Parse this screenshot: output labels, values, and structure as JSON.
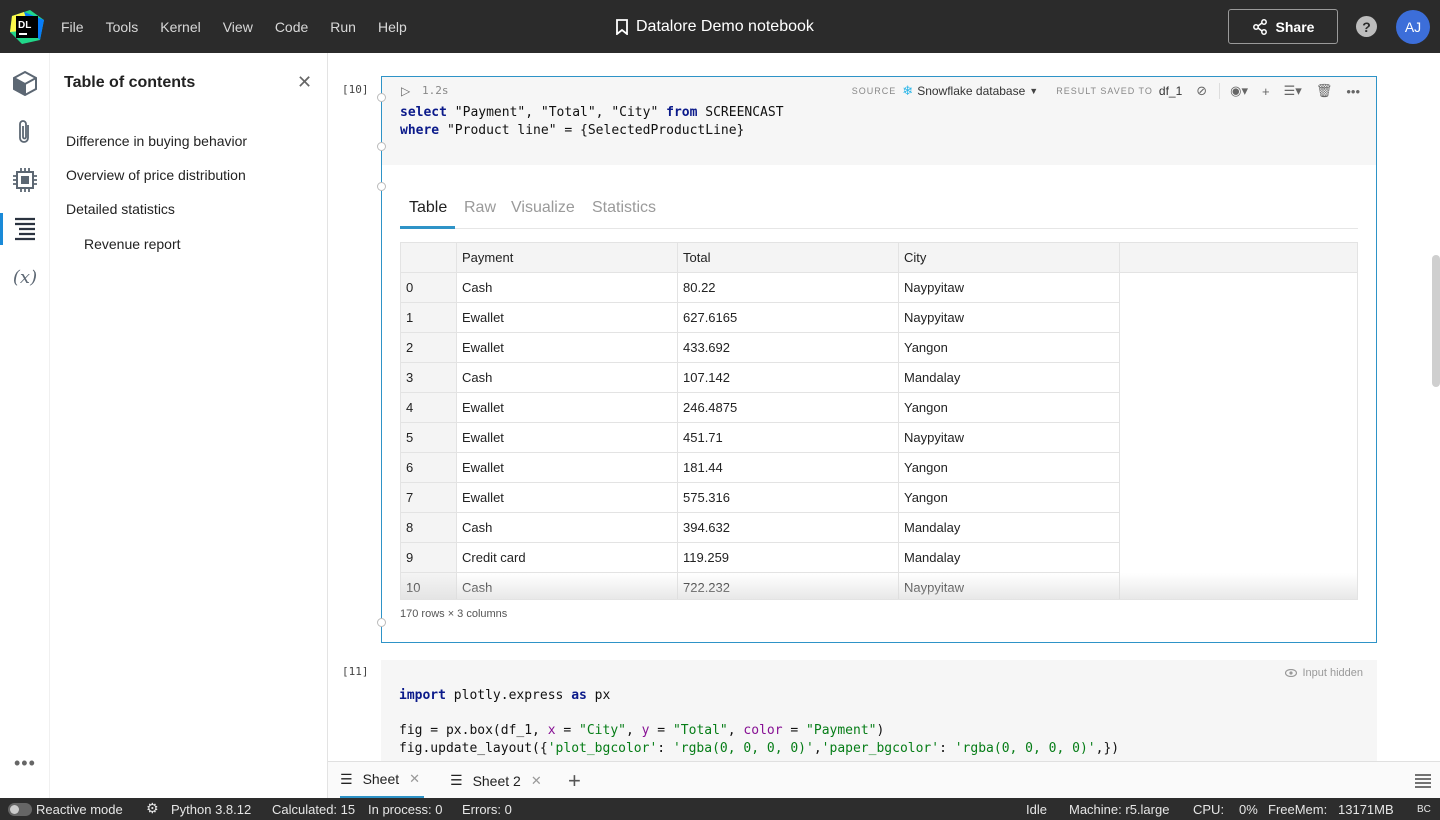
{
  "menubar": {
    "items": [
      "File",
      "Tools",
      "Kernel",
      "View",
      "Code",
      "Run",
      "Help"
    ],
    "notebook_title": "Datalore Demo notebook",
    "share_label": "Share",
    "help_label": "?",
    "avatar_initials": "AJ",
    "logo_text": "DL"
  },
  "toc": {
    "title": "Table of contents",
    "items": [
      "Difference in buying behavior",
      "Overview of price distribution",
      "Detailed statistics",
      "Revenue report"
    ]
  },
  "cell1": {
    "number": "[10]",
    "run_time": "1.2s",
    "source_label": "SOURCE",
    "source_value": "Snowflake database",
    "result_label": "RESULT SAVED TO",
    "result_value": "df_1",
    "code_line1_kw": "select",
    "code_line1_rest": " \"Payment\", \"Total\", \"City\" ",
    "code_line1_kw2": "from",
    "code_line1_end": " SCREENCAST",
    "code_line2_kw": "where",
    "code_line2_rest": " \"Product line\" = {SelectedProductLine}",
    "tabs": [
      "Table",
      "Raw",
      "Visualize",
      "Statistics"
    ],
    "active_tab": "Table",
    "columns": [
      "Payment",
      "Total",
      "City"
    ],
    "rows": [
      [
        "0",
        "Cash",
        "80.22",
        "Naypyitaw"
      ],
      [
        "1",
        "Ewallet",
        "627.6165",
        "Naypyitaw"
      ],
      [
        "2",
        "Ewallet",
        "433.692",
        "Yangon"
      ],
      [
        "3",
        "Cash",
        "107.142",
        "Mandalay"
      ],
      [
        "4",
        "Ewallet",
        "246.4875",
        "Yangon"
      ],
      [
        "5",
        "Ewallet",
        "451.71",
        "Naypyitaw"
      ],
      [
        "6",
        "Ewallet",
        "181.44",
        "Yangon"
      ],
      [
        "7",
        "Ewallet",
        "575.316",
        "Yangon"
      ],
      [
        "8",
        "Cash",
        "394.632",
        "Mandalay"
      ],
      [
        "9",
        "Credit card",
        "119.259",
        "Mandalay"
      ],
      [
        "10",
        "Cash",
        "722.232",
        "Naypyitaw"
      ]
    ],
    "table_info": "170 rows × 3 columns"
  },
  "cell2": {
    "number": "[11]",
    "input_hidden_label": "Input hidden",
    "line1_kw": "import",
    "line1_mid": " plotly.express ",
    "line1_kw2": "as",
    "line1_end": " px",
    "line3_a": "fig = px.box(df_1, ",
    "line3_x": "x",
    "line3_b": " = ",
    "line3_city": "\"City\"",
    "line3_c": ", ",
    "line3_y": "y",
    "line3_d": " = ",
    "line3_total": "\"Total\"",
    "line3_e": ", ",
    "line3_color": "color",
    "line3_f": " = ",
    "line3_payment": "\"Payment\"",
    "line3_g": ")",
    "line4_a": "fig.update_layout({",
    "line4_k1": "'plot_bgcolor'",
    "line4_b": ": ",
    "line4_v1": "'rgba(0, 0, 0, 0)'",
    "line4_c": ",",
    "line4_k2": "'paper_bgcolor'",
    "line4_d": ": ",
    "line4_v2": "'rgba(0, 0, 0, 0)'",
    "line4_e": ",})"
  },
  "sheets": {
    "tabs": [
      "Sheet",
      "Sheet 2"
    ],
    "active": "Sheet"
  },
  "statusbar": {
    "reactive_mode": "Reactive mode",
    "python": "Python 3.8.12",
    "calculated": "Calculated: 15",
    "in_process": "In process: 0",
    "errors": "Errors: 0",
    "state": "Idle",
    "machine": "Machine: r5.large",
    "cpu_label": "CPU:",
    "cpu_value": "0%",
    "freemem_label": "FreeMem:",
    "freemem_value": "13171MB",
    "encoding": "BC"
  },
  "colors": {
    "accent": "#2e93c7",
    "topbar": "#2b2b2b",
    "avatar": "#3c6ed9",
    "keyword": "#0b1a8a",
    "string": "#067d17",
    "param": "#871094"
  }
}
